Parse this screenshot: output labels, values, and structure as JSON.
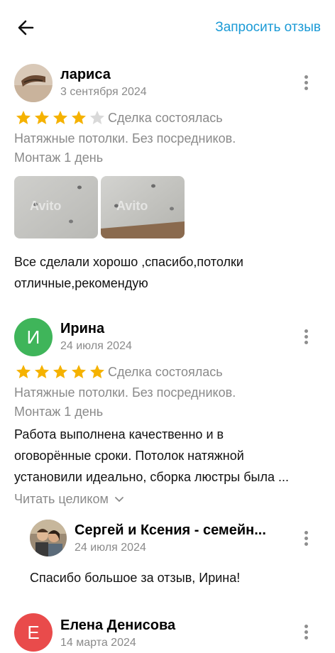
{
  "header": {
    "back_icon": "arrow-left-icon",
    "request_review_label": "Запросить отзыв",
    "accent_color": "#1a9ad6"
  },
  "reviews": [
    {
      "author": "лариса",
      "date": "3 сентября 2024",
      "rating": 4,
      "max_rating": 5,
      "deal_status": "Сделка состоялась",
      "meta_line1": "Натяжные потолки. Без посредников.",
      "meta_line2": "Монтаж 1 день",
      "photo_watermark": "Avito",
      "text_line1": "Все сделали хорошо ,спасибо,потолки",
      "text_line2": "отличные,рекомендую"
    },
    {
      "author": "Ирина",
      "avatar_letter": "И",
      "avatar_color": "#3fb55a",
      "date": "24 июля 2024",
      "rating": 5,
      "max_rating": 5,
      "deal_status": "Сделка состоялась",
      "meta_line1": "Натяжные потолки. Без посредников.",
      "meta_line2": "Монтаж 1 день",
      "text_line1": "Работа выполнена качественно и в",
      "text_line2": "оговорённые сроки. Потолок натяжной",
      "text_line3": "установили идеально, сборка люстры была ...",
      "read_more": "Читать целиком",
      "reply": {
        "author": "Сергей и Ксения - семейн...",
        "date": "24 июля 2024",
        "text": "Спасибо большое за отзыв, Ирина!"
      }
    },
    {
      "author": "Елена Денисова",
      "avatar_letter": "Е",
      "avatar_color": "#e94b4b",
      "date": "14 марта 2024"
    }
  ],
  "colors": {
    "star_filled": "#f5b200",
    "star_empty": "#d9d9d9",
    "secondary_text": "#8a8a8a"
  }
}
